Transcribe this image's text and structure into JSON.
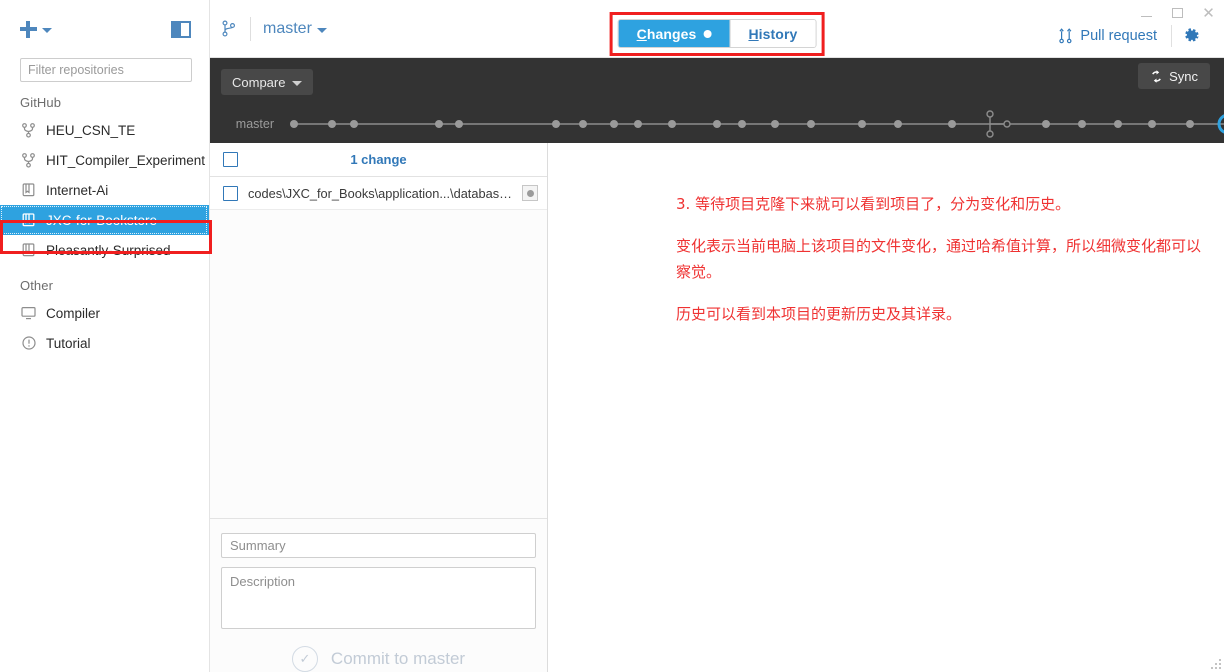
{
  "window": {
    "minimize_label": "–",
    "maximize_label": "□",
    "close_label": "×"
  },
  "sidebar": {
    "add_icon": "plus-icon",
    "add_caret": "chevron-down-icon",
    "panel_toggle_icon": "panel-toggle-icon",
    "filter": {
      "placeholder": "Filter repositories",
      "value": ""
    },
    "groups": [
      {
        "label": "GitHub",
        "items": [
          {
            "label": "HEU_CSN_TE",
            "icon": "fork-icon",
            "selected": false
          },
          {
            "label": "HIT_Compiler_Experiment",
            "icon": "fork-icon",
            "selected": false
          },
          {
            "label": "Internet-Ai",
            "icon": "book-icon",
            "selected": false
          },
          {
            "label": "JXC-for-Bookstore",
            "icon": "book-icon",
            "selected": true
          },
          {
            "label": "Pleasantly-Surprised",
            "icon": "book-icon",
            "selected": false
          }
        ]
      },
      {
        "label": "Other",
        "items": [
          {
            "label": "Compiler",
            "icon": "monitor-icon",
            "selected": false
          },
          {
            "label": "Tutorial",
            "icon": "info-circle-icon",
            "selected": false
          }
        ]
      }
    ]
  },
  "header": {
    "branch_icon": "branch-icon",
    "branch_name": "master",
    "branch_caret": "chevron-down-icon",
    "tabs": [
      {
        "acc": "C",
        "rest": "hanges",
        "active": true,
        "dot": true
      },
      {
        "acc": "H",
        "rest": "istory",
        "active": false,
        "dot": false
      }
    ],
    "pull_request_label": "Pull request",
    "pull_request_icon": "pull-request-icon",
    "gear_icon": "gear-icon"
  },
  "graph": {
    "compare_label": "Compare",
    "compare_caret": "chevron-down-icon",
    "sync_label": "Sync",
    "sync_icon": "sync-icon",
    "branch_row_label": "master"
  },
  "changes": {
    "select_all_checked": false,
    "count_label": "1 change",
    "files": [
      {
        "path": "codes\\JXC_for_Books\\application...\\database.php",
        "checked": false,
        "status_icon": "modified-dot-icon"
      }
    ],
    "summary": {
      "placeholder": "Summary",
      "value": ""
    },
    "description": {
      "placeholder": "Description",
      "value": ""
    },
    "commit_button_label": "Commit to master",
    "commit_check_icon": "check-circle-icon"
  },
  "annotations": {
    "paragraphs": [
      "3. 等待项目克隆下来就可以看到项目了，分为变化和历史。",
      "变化表示当前电脑上该项目的文件变化，通过哈希值计算，所以细微变化都可以察觉。",
      "历史可以看到本项目的更新历史及其详录。"
    ],
    "color": "#ef3232"
  },
  "colors": {
    "accent_blue": "#2ea2e0",
    "link_blue": "#3178b8",
    "dark_bar": "#333333",
    "annotation_red": "#f01f1f"
  }
}
